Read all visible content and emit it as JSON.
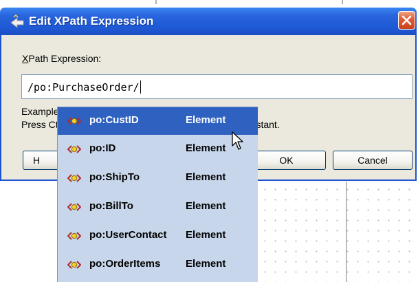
{
  "dialog": {
    "title": "Edit XPath Expression",
    "expression_label_mnemonic": "X",
    "expression_label_rest": "Path Expression:",
    "expression_value": "/po:PurchaseOrder/",
    "hint_line1": "Example",
    "hint_line2_start": "Press Ct",
    "hint_line2_end": "Assistant.",
    "help_label": "H",
    "ok_label": "OK",
    "cancel_label": "Cancel"
  },
  "autocomplete": {
    "selected_index": 0,
    "items": [
      {
        "name": "po:CustID",
        "type": "Element"
      },
      {
        "name": "po:ID",
        "type": "Element"
      },
      {
        "name": "po:ShipTo",
        "type": "Element"
      },
      {
        "name": "po:BillTo",
        "type": "Element"
      },
      {
        "name": "po:UserContact",
        "type": "Element"
      },
      {
        "name": "po:OrderItems",
        "type": "Element"
      }
    ],
    "icon": "element-icon"
  },
  "colors": {
    "titlebar": "#2864db",
    "selection": "#2f61c1",
    "popup_bg": "#c7d6ea",
    "dialog_bg": "#ebe9dd",
    "close_button": "#e0603c"
  }
}
